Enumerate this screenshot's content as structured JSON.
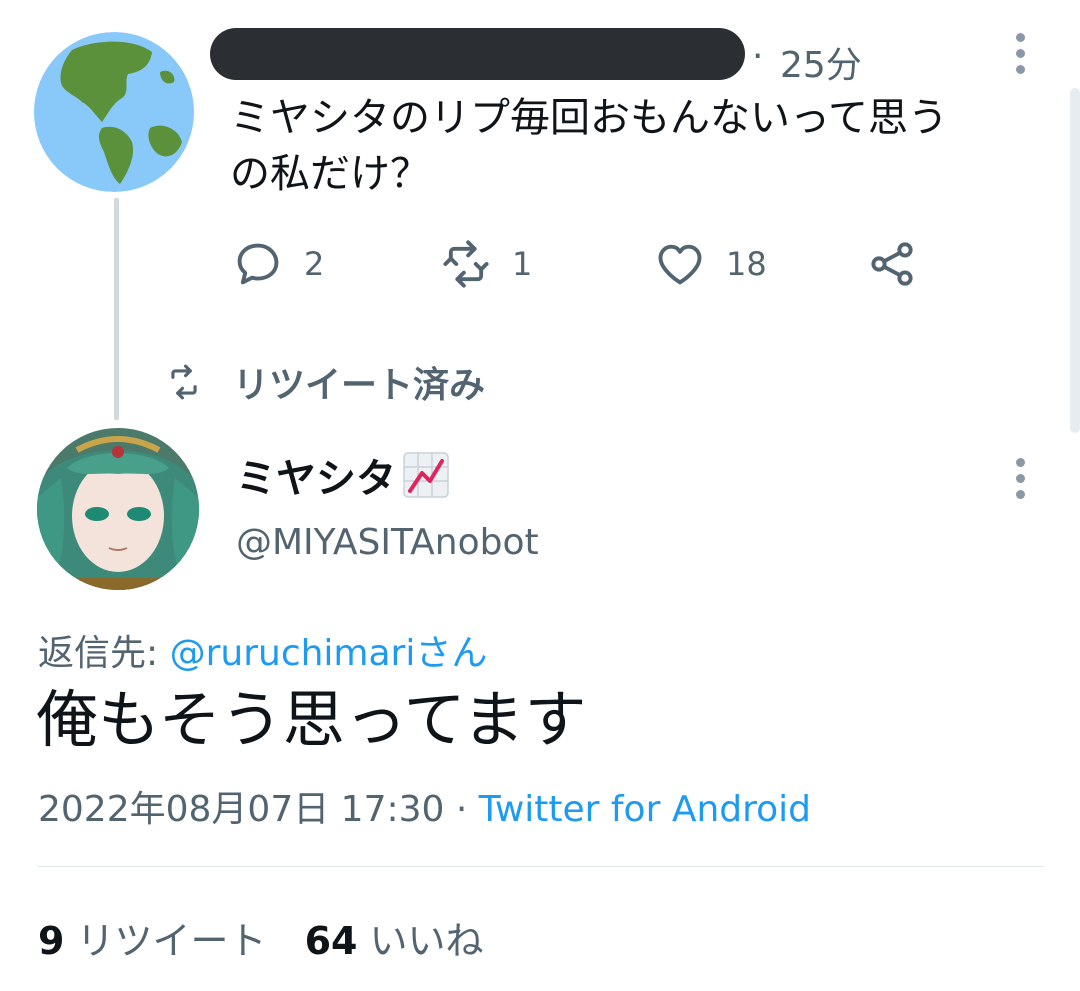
{
  "parent_tweet": {
    "time": "25分",
    "text": "ミヤシタのリプ毎回おもんないって思うの私だけ？",
    "text_line1": "ミヤシタのリプ毎回おもんないって思う",
    "text_line2": "の私だけ？",
    "actions": {
      "reply_count": "2",
      "retweet_count": "1",
      "like_count": "18"
    }
  },
  "retweet_label": "リツイート済み",
  "tweet": {
    "display_name": "ミヤシタ",
    "handle": "@MIYASITAnobot",
    "reply_prefix": "返信先: ",
    "reply_to": "@ruruchimariさん",
    "text": "俺もそう思ってます",
    "timestamp": "2022年08月07日 17:30",
    "separator": " · ",
    "source": "Twitter for Android",
    "stats": {
      "retweet_count": "9",
      "retweet_label": "リツイート",
      "like_count": "64",
      "like_label": "いいね"
    }
  },
  "colors": {
    "link": "#1d9bf0",
    "secondary_text": "#536471",
    "thread_line": "#cfd9de"
  }
}
